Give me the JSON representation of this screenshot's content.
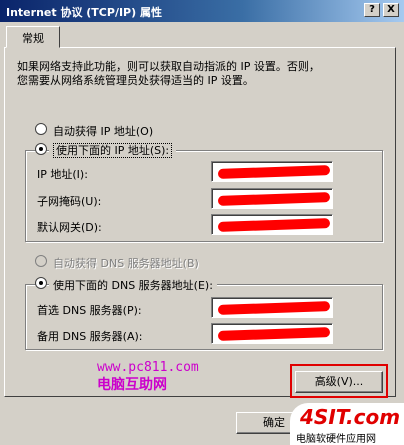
{
  "window": {
    "title": "Internet 协议 (TCP/IP) 属性",
    "help_label": "?",
    "close_label": "X"
  },
  "tabs": [
    {
      "label": "常规"
    }
  ],
  "description": [
    "如果网络支持此功能，则可以获取自动指派的 IP 设置。否则，",
    "您需要从网络系统管理员处获得适当的 IP 设置。"
  ],
  "ip": {
    "auto_label": "自动获得 IP 地址(O)",
    "manual_label": "使用下面的 IP 地址(S):",
    "selected": "manual",
    "fields": [
      {
        "label": "IP 地址(I):"
      },
      {
        "label": "子网掩码(U):"
      },
      {
        "label": "默认网关(D):"
      }
    ]
  },
  "dns": {
    "auto_label": "自动获得 DNS 服务器地址(B)",
    "manual_label": "使用下面的 DNS 服务器地址(E):",
    "selected": "manual",
    "fields": [
      {
        "label": "首选 DNS 服务器(P):"
      },
      {
        "label": "备用 DNS 服务器(A):"
      }
    ]
  },
  "buttons": {
    "advanced_label": "高级(V)...",
    "ok_label": "确定"
  },
  "watermarks": {
    "url": "www.pc811.com",
    "site_name": "电脑互助网",
    "logo_text": "4SIT.com",
    "logo_caption": "电脑软硬件应用网"
  },
  "colors": {
    "titlebar_start": "#0a246a",
    "dialog_bg": "#d4d0c8",
    "annotation_red": "#e00000",
    "watermark_magenta": "#cc00cc"
  }
}
